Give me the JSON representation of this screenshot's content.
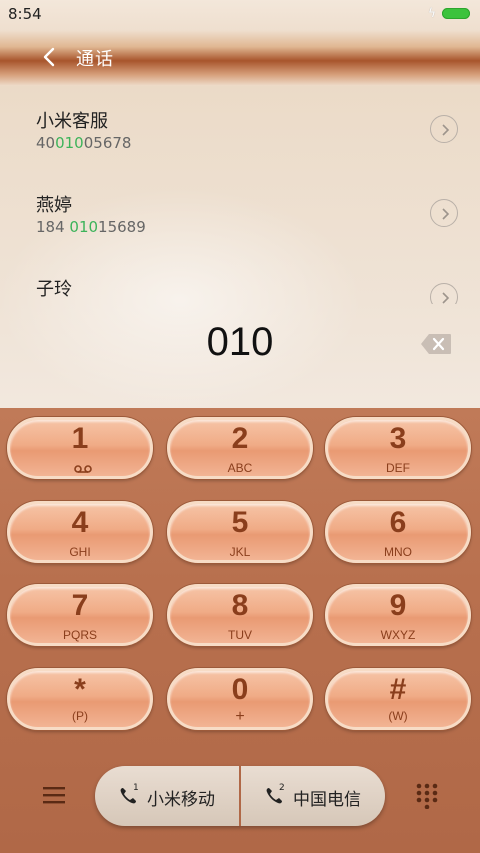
{
  "status_bar": {
    "time": "8:54",
    "bolt": "ϟ"
  },
  "header": {
    "title": "通话"
  },
  "contacts": [
    {
      "name": "小米客服",
      "number_pre": "40",
      "number_match": "010",
      "number_post": "05678"
    },
    {
      "name": "燕婷",
      "number_pre": "184 ",
      "number_match": "010",
      "number_post": "15689"
    },
    {
      "name": "子玲",
      "number_pre": "",
      "number_match": "",
      "number_post": ""
    }
  ],
  "dialed": "010",
  "keypad": [
    {
      "digit": "1",
      "sub": ""
    },
    {
      "digit": "2",
      "sub": "ABC"
    },
    {
      "digit": "3",
      "sub": "DEF"
    },
    {
      "digit": "4",
      "sub": "GHI"
    },
    {
      "digit": "5",
      "sub": "JKL"
    },
    {
      "digit": "6",
      "sub": "MNO"
    },
    {
      "digit": "7",
      "sub": "PQRS"
    },
    {
      "digit": "8",
      "sub": "TUV"
    },
    {
      "digit": "9",
      "sub": "WXYZ"
    },
    {
      "digit": "*",
      "sub": "(P)"
    },
    {
      "digit": "0",
      "sub": "+"
    },
    {
      "digit": "#",
      "sub": "(W)"
    }
  ],
  "sim": [
    {
      "label": "小米移动",
      "slot": "1"
    },
    {
      "label": "中国电信",
      "slot": "2"
    }
  ],
  "colors": {
    "match": "#3cb35a",
    "key_text": "#8a3e1c",
    "battery": "#3cc33c"
  }
}
